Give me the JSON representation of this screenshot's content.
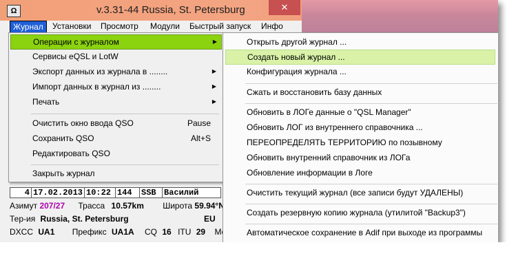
{
  "window": {
    "sys_icon": "Ω",
    "title": "v.3.31-44 Russia, St. Petersburg",
    "min": "—",
    "max": "☐",
    "close": "✕"
  },
  "menubar": [
    {
      "label": "Журнал"
    },
    {
      "label": "Установки"
    },
    {
      "label": "Просмотр"
    },
    {
      "label": "Модули"
    },
    {
      "label": "Быстрый запуск"
    },
    {
      "label": "Инфо"
    }
  ],
  "journal_menu": {
    "ops": "Операции с журналом",
    "eqsl": "Сервисы eQSL и LotW",
    "export": "Экспорт данных из журнала в ........",
    "import": "Импорт  данных в  журнал   из ........",
    "print": "Печать",
    "clear_qso": "Очистить окно ввода QSO",
    "clear_qso_sc": "Pause",
    "save_qso": "Сохранить QSO",
    "save_qso_sc": "Alt+S",
    "edit_qso": "Редактировать QSO",
    "close_log": "Закрыть журнал"
  },
  "ops_submenu": {
    "open_other": "Открыть другой журнал ...",
    "create_new": "Создать  новый  журнал ...",
    "config": "Конфигурация  журнала ...",
    "compress": "Сжать и восстановить базу данных",
    "update_qsl": "Обновить в ЛОГе данные о \"QSL Manager\"",
    "update_log": "Обновить ЛОГ из внутреннего справочника ...",
    "redefine": "ПЕРЕОПРЕДЕЛЯТЬ ТЕРРИТОРИЮ по позывному",
    "update_ref": "Обновить внутренний справочник из ЛОГа",
    "update_info": "Обновление информации в Логе",
    "clear_log": "Очистить текущий журнал (все записи будут УДАЛЕНЫ)",
    "backup": "Создать резервную копию журнала  (утилитой  \"Backup3\")",
    "autosave": "Автоматическое сохранение в Adif при выходе из программы"
  },
  "log_row": {
    "num": "4",
    "date": "17.02.2013",
    "time": "10:22",
    "band": "144",
    "mode": "SSB",
    "name": "Василий"
  },
  "info": {
    "azimuth_label": "Азимут",
    "azimuth_value": "207/27",
    "route_label": "Трасса",
    "route_value": "10.57km",
    "lat_label": "Широта",
    "lat_value": "59.94°N",
    "terr_label": "Тер-ия",
    "terr_value": "Russia, St. Petersburg",
    "continent": "EU",
    "dxcc_label": "DXCC",
    "dxcc_value": "UA1",
    "prefix_label": "Префикс",
    "prefix_value": "UA1A",
    "cq_label": "CQ",
    "cq_value": "16",
    "itu_label": "ITU",
    "itu_value": "29",
    "my_label": "Моя О"
  }
}
